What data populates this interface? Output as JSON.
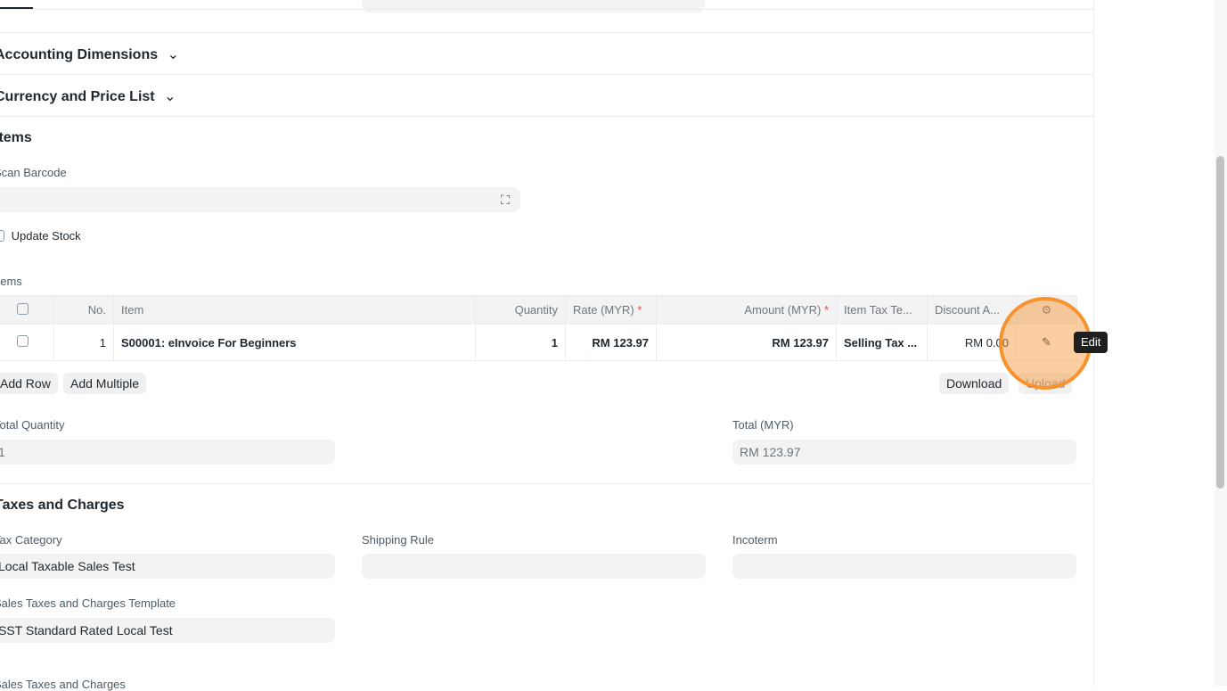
{
  "sections": {
    "accounting": "Accounting Dimensions",
    "currency": "Currency and Price List",
    "items": "Items",
    "taxes": "Taxes and Charges"
  },
  "scan_barcode": {
    "label": "Scan Barcode",
    "value": ""
  },
  "update_stock": {
    "label": "Update Stock",
    "checked": false
  },
  "items_table": {
    "label": "Items",
    "headers": [
      "No.",
      "Item",
      "Quantity",
      "Rate (MYR)",
      "Amount (MYR)",
      "Item Tax Te...",
      "Discount A..."
    ],
    "required_mark": "*",
    "rows": [
      {
        "no": "1",
        "item": "S00001: eInvoice For Beginners",
        "quantity": "1",
        "rate": "RM 123.97",
        "amount": "RM 123.97",
        "item_tax": "Selling Tax ...",
        "discount": "RM 0.00"
      }
    ],
    "add_row": "Add Row",
    "add_multiple": "Add Multiple",
    "download": "Download",
    "upload": "Upload",
    "tooltip": "Edit"
  },
  "totals": {
    "qty_label": "Total Quantity",
    "qty": "1",
    "total_label": "Total (MYR)",
    "total": "RM 123.97"
  },
  "tax": {
    "category_label": "Tax Category",
    "category": "Local Taxable Sales Test",
    "shipping_label": "Shipping Rule",
    "shipping": "",
    "incoterm_label": "Incoterm",
    "incoterm": "",
    "template_label": "Sales Taxes and Charges Template",
    "template": "SST Standard Rated Local Test",
    "charges_label": "Sales Taxes and Charges"
  },
  "colors": {
    "highlight": "#f7922e",
    "tooltip": "#1f1f1f"
  }
}
